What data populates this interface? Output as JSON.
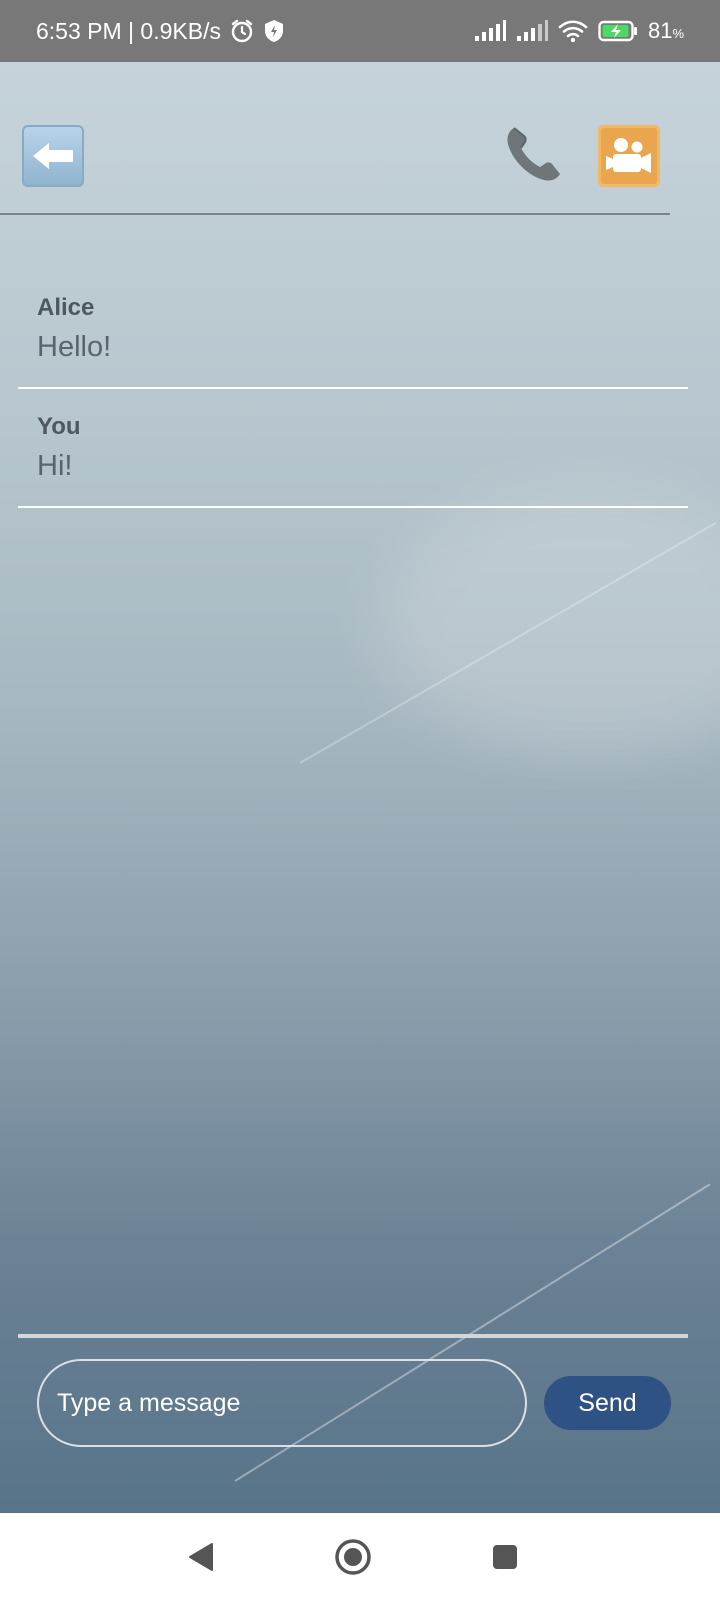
{
  "status_bar": {
    "time_speed": "6:53 PM | 0.9KB/s",
    "battery_value": "81",
    "battery_unit": "%",
    "icons": [
      "alarm-icon",
      "shield-icon",
      "signal-icon",
      "signal-icon-2",
      "wifi-icon",
      "battery-charging-icon"
    ]
  },
  "header": {
    "back_icon": "left-arrow-icon",
    "call_icon": "phone-icon",
    "video_icon": "video-camera-icon"
  },
  "messages": [
    {
      "sender": "Alice",
      "text": "Hello!"
    },
    {
      "sender": "You",
      "text": "Hi!"
    }
  ],
  "composer": {
    "input_value": "",
    "placeholder": "Type a message",
    "send_label": "Send"
  },
  "nav_bar": {
    "icons": [
      "back-triangle-icon",
      "home-circle-icon",
      "recents-square-icon"
    ]
  },
  "colors": {
    "send_button": "#2f5284",
    "video_button": "#e9a64f",
    "back_button": "#a3c4de",
    "status_bar": "#787878"
  }
}
